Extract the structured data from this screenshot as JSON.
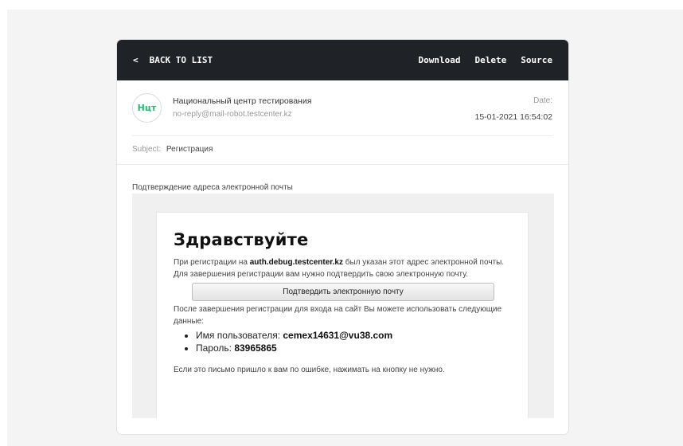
{
  "toolbar": {
    "back_chevron": "<",
    "back_label": "BACK TO LIST",
    "download_label": "Download",
    "delete_label": "Delete",
    "source_label": "Source"
  },
  "sender": {
    "avatar_initials": "Нцт",
    "name": "Национальный центр тестирования",
    "email": "no-reply@mail-robot.testcenter.kz",
    "date_label": "Date:",
    "date_value": "15-01-2021 16:54:02"
  },
  "subject": {
    "label": "Subject:",
    "value": "Регистрация"
  },
  "preview_text": "Подтверждение адреса электронной почты",
  "mail_body": {
    "heading": "Здравствуйте",
    "intro_prefix": "При регистрации на ",
    "intro_domain": "auth.debug.testcenter.kz",
    "intro_suffix": " был указан этот адрес электронной почты. Для завершения регистрации вам нужно подтвердить свою электронную почту.",
    "confirm_button": "Подтвердить электронную почту",
    "after_text": "После завершения регистрации для входа на сайт Вы можете использовать следующие данные:",
    "username_label": "Имя пользователя: ",
    "username_value": "cemex14631@vu38.com",
    "password_label": "Пароль: ",
    "password_value": "83965865",
    "footnote": "Если это письмо пришло к вам по ошибке, нажимать на кнопку не нужно."
  },
  "colors": {
    "topbar_bg": "#1f2227",
    "avatar_text": "#2bb673",
    "page_bg": "#f4f4f5"
  },
  "icons": {
    "back": "chevron-left-icon"
  }
}
